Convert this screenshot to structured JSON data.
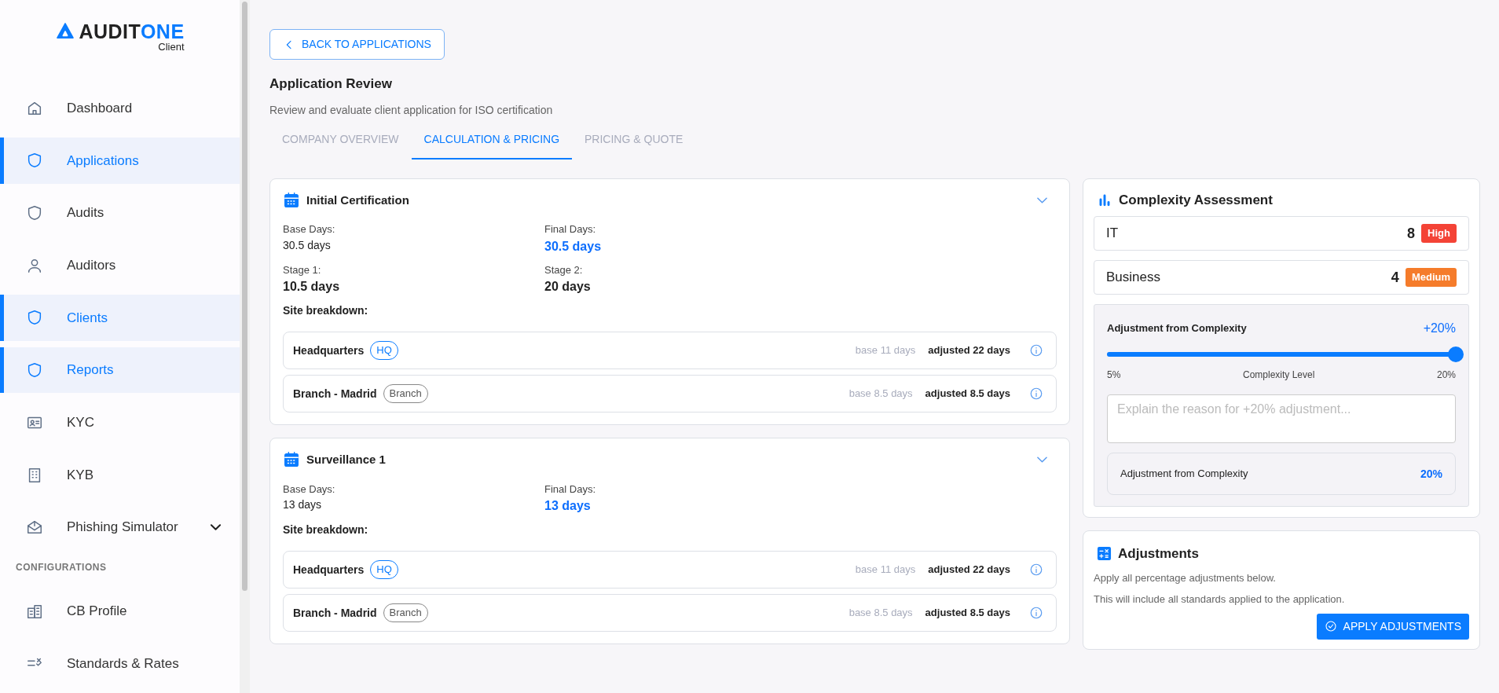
{
  "sidebar": {
    "logo": {
      "brand_a": "AUDIT",
      "brand_b": "ONE",
      "sub": "Client"
    },
    "items": [
      {
        "label": "Dashboard",
        "selected": false
      },
      {
        "label": "Applications",
        "selected": true
      },
      {
        "label": "Audits",
        "selected": false
      },
      {
        "label": "Auditors",
        "selected": false
      },
      {
        "label": "Clients",
        "selected": true
      },
      {
        "label": "Reports",
        "selected": true
      },
      {
        "label": "KYC",
        "selected": false
      },
      {
        "label": "KYB",
        "selected": false
      },
      {
        "label": "Phishing Simulator",
        "selected": false,
        "expandable": true
      }
    ],
    "section_title": "CONFIGURATIONS",
    "config_items": [
      {
        "label": "CB Profile",
        "selected": false
      },
      {
        "label": "Standards & Rates",
        "selected": false
      }
    ]
  },
  "back_button": "BACK TO APPLICATIONS",
  "title": "Application Review",
  "subtitle": "Review and evaluate client application for ISO certification",
  "tabs": [
    {
      "label": "COMPANY OVERVIEW",
      "selected": false
    },
    {
      "label": "CALCULATION & PRICING",
      "selected": true
    },
    {
      "label": "PRICING & QUOTE",
      "selected": false
    }
  ],
  "audits": [
    {
      "title": "Initial Certification",
      "base_label": "Base Days:",
      "base_value": "30.5 days",
      "final_label": "Final Days:",
      "final_value": "30.5 days",
      "stages": [
        {
          "label": "Stage 1:",
          "value": "10.5 days"
        },
        {
          "label": "Stage 2:",
          "value": "20 days"
        }
      ],
      "breakdown_label": "Site breakdown:",
      "sites": [
        {
          "name": "Headquarters",
          "tag": "HQ",
          "kind": "hq",
          "base": "base 11 days",
          "adjusted": "adjusted 22 days"
        },
        {
          "name": "Branch - Madrid",
          "tag": "Branch",
          "kind": "branch",
          "base": "base 8.5 days",
          "adjusted": "adjusted 8.5 days"
        }
      ]
    },
    {
      "title": "Surveillance 1",
      "base_label": "Base Days:",
      "base_value": "13 days",
      "final_label": "Final Days:",
      "final_value": "13 days",
      "breakdown_label": "Site breakdown:",
      "sites": [
        {
          "name": "Headquarters",
          "tag": "HQ",
          "kind": "hq",
          "base": "base 11 days",
          "adjusted": "adjusted 22 days"
        },
        {
          "name": "Branch - Madrid",
          "tag": "Branch",
          "kind": "branch",
          "base": "base 8.5 days",
          "adjusted": "adjusted 8.5 days"
        }
      ]
    }
  ],
  "complexity": {
    "title": "Complexity Assessment",
    "rows": [
      {
        "label": "IT",
        "score": "8",
        "badge": "High",
        "color": "#f44336"
      },
      {
        "label": "Business",
        "score": "4",
        "badge": "Medium",
        "color": "#f57c2b"
      }
    ],
    "adjustment": {
      "title": "Adjustment from Complexity",
      "value": "+20%",
      "level": 1.0,
      "min": "5%",
      "mid": "Complexity Level",
      "max": "20%",
      "placeholder": "Explain the reason for +20% adjustment...",
      "summary_label": "Adjustment from Complexity",
      "summary_value": "20%"
    }
  },
  "adjustments": {
    "title": "Adjustments",
    "lines": [
      "Apply all percentage adjustments below.",
      "This will include all standards applied to the application."
    ],
    "button": "APPLY ADJUSTMENTS"
  }
}
